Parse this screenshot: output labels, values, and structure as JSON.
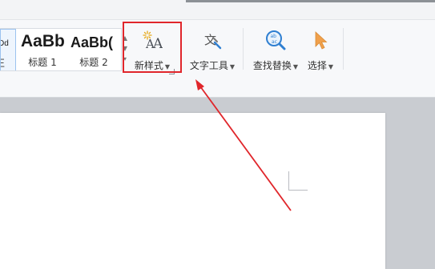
{
  "ribbon": {
    "style_gallery": {
      "items": [
        {
          "sample": "cDd",
          "name": "正"
        },
        {
          "sample": "AaBb",
          "name": "标题 1"
        },
        {
          "sample": "AaBb(",
          "name": "标题 2"
        }
      ]
    },
    "new_style": {
      "label": "新样式",
      "icon": "new-style-icon"
    },
    "text_tools": {
      "label": "文字工具",
      "icon": "text-tools-icon"
    },
    "find_replace": {
      "label": "查找替换",
      "icon": "find-replace-icon"
    },
    "select": {
      "label": "选择",
      "icon": "cursor-arrow-icon"
    }
  },
  "annotation": {
    "color": "#e0262b",
    "target": "new_style"
  },
  "colors": {
    "ribbon_bg": "#f7f8fa",
    "workspace_bg": "#c9ccd1",
    "page_bg": "#ffffff",
    "select_icon": "#f0a04b"
  }
}
